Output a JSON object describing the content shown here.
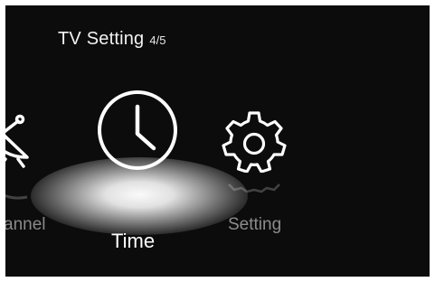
{
  "header": {
    "title": "TV Setting",
    "page_indicator": "4/5"
  },
  "menu": {
    "selected_index": 1,
    "items": [
      {
        "label": "Channel",
        "visible_label": "annel",
        "icon": "satellite-dish-icon",
        "selected": false
      },
      {
        "label": "Time",
        "visible_label": "Time",
        "icon": "clock-icon",
        "selected": true
      },
      {
        "label": "Setting",
        "visible_label": "Setting",
        "icon": "gear-icon",
        "selected": false
      }
    ]
  },
  "colors": {
    "background": "#0c0c0c",
    "selected_text": "#ffffff",
    "unselected_text": "#8a8a8a",
    "icon_stroke": "#ffffff"
  }
}
